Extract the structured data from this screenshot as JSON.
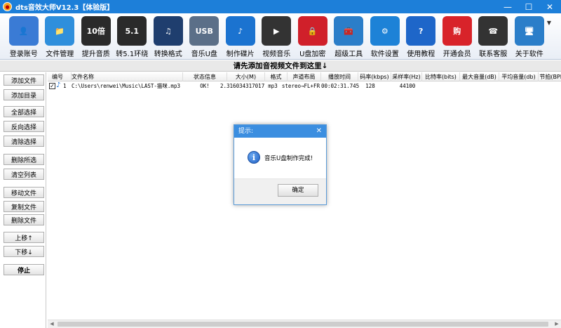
{
  "window": {
    "title": "dts音效大师V12.3【体验版】",
    "controls": {
      "minimize": "—",
      "maximize": "☐",
      "close": "✕"
    }
  },
  "toolbar": {
    "items": [
      {
        "label": "登录账号",
        "icon": "user-icon",
        "glyph": "👤",
        "color": "#3a7bd5"
      },
      {
        "label": "文件管理",
        "icon": "folder-icon",
        "glyph": "📁",
        "color": "#2f8fdc"
      },
      {
        "label": "提升音质",
        "icon": "headphones-10x-icon",
        "glyph": "10倍",
        "color": "#2a2a2a"
      },
      {
        "label": "转5.1环绕",
        "icon": "headphones-51-icon",
        "glyph": "5.1",
        "color": "#2a2a2a"
      },
      {
        "label": "转换格式",
        "icon": "music-note-icon",
        "glyph": "♫",
        "color": "#1f3e6e"
      },
      {
        "label": "音乐U盘",
        "icon": "usb-drive-icon",
        "glyph": "USB",
        "color": "#5b6f88"
      },
      {
        "label": "制作碟片",
        "icon": "music-disc-icon",
        "glyph": "♪",
        "color": "#1b73d0"
      },
      {
        "label": "视频音乐",
        "icon": "video-clapper-icon",
        "glyph": "▶",
        "color": "#333333"
      },
      {
        "label": "U盘加密",
        "icon": "usb-lock-icon",
        "glyph": "🔒",
        "color": "#d0202a"
      },
      {
        "label": "超级工具",
        "icon": "toolbox-icon",
        "glyph": "🧰",
        "color": "#2b7ec9"
      },
      {
        "label": "软件设置",
        "icon": "gear-icon",
        "glyph": "⚙",
        "color": "#1d82d7"
      },
      {
        "label": "使用教程",
        "icon": "help-icon",
        "glyph": "?",
        "color": "#1e66c9"
      },
      {
        "label": "开通会员",
        "icon": "shopping-icon",
        "glyph": "购",
        "color": "#d8232a"
      },
      {
        "label": "联系客服",
        "icon": "support-agent-icon",
        "glyph": "☎",
        "color": "#333333"
      },
      {
        "label": "关于软件",
        "icon": "about-computer-icon",
        "glyph": "🖥",
        "color": "#2b7ec9"
      }
    ],
    "more_glyph": "▼"
  },
  "dropbar": {
    "text": "请先添加音视频文件到这里↓"
  },
  "sidebar": {
    "buttons": [
      {
        "label": "添加文件",
        "name": "add-file-button"
      },
      {
        "label": "添加目录",
        "name": "add-folder-button"
      },
      {
        "label": "全部选择",
        "name": "select-all-button"
      },
      {
        "label": "反向选择",
        "name": "invert-selection-button"
      },
      {
        "label": "清除选择",
        "name": "clear-selection-button"
      },
      {
        "label": "删除所选",
        "name": "delete-selected-button"
      },
      {
        "label": "清空列表",
        "name": "clear-list-button"
      },
      {
        "label": "移动文件",
        "name": "move-file-button"
      },
      {
        "label": "复制文件",
        "name": "copy-file-button"
      },
      {
        "label": "删除文件",
        "name": "delete-file-button"
      },
      {
        "label": "上移↑",
        "name": "move-up-button"
      },
      {
        "label": "下移↓",
        "name": "move-down-button"
      },
      {
        "label": "停止",
        "name": "stop-button"
      }
    ]
  },
  "table": {
    "columns": [
      "编号",
      "文件名称",
      "状态信息",
      "大小(M)",
      "格式",
      "声道布局",
      "播放时间",
      "码率(kbps)",
      "采样率(Hz)",
      "比特率(bits)",
      "最大音量(dB)",
      "平均音量(db)",
      "节拍(BPM"
    ],
    "rows": [
      {
        "checked": true,
        "index": "1",
        "filename": "C:\\Users\\renwei\\Music\\LAST-猫咪.mp3",
        "status": "OK!",
        "size": "2.316034317017",
        "format": "mp3",
        "channels": "stereo→FL+FR",
        "duration": "00:02:31.745",
        "bitrate": "128",
        "samplerate": "44100",
        "bits": "",
        "maxvol": "",
        "avgvol": "",
        "bpm": ""
      }
    ]
  },
  "dialog": {
    "title": "提示:",
    "close": "✕",
    "message": "音乐U盘制作完成!",
    "ok_label": "确定"
  },
  "scrollbar": {
    "left_arrow": "◀",
    "right_arrow": "▶"
  }
}
